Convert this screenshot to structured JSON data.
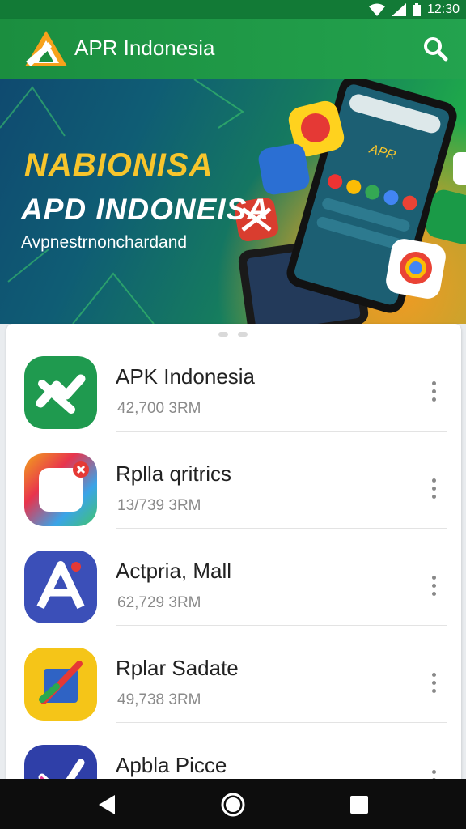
{
  "status_bar": {
    "time": "12:30",
    "icons": [
      "wifi-icon",
      "signal-icon",
      "battery-icon"
    ]
  },
  "app_bar": {
    "title": "APR Indonesia",
    "search_icon": "search-icon"
  },
  "banner": {
    "headline_1": "NABIONISA",
    "headline_2": "APD INDONEISA",
    "subtitle": "Avpnestrnonchardand",
    "phone_screen_label": "APR"
  },
  "apps": [
    {
      "name": "APK Indonesia",
      "meta": "42,700 3RM",
      "icon": "apk-indonesia-icon"
    },
    {
      "name": "Rplla qritrics",
      "meta": "13/739 3RM",
      "icon": "rplla-qritrics-icon"
    },
    {
      "name": "Actpria, Mall",
      "meta": "62,729 3RM",
      "icon": "actpria-mall-icon"
    },
    {
      "name": "Rplar Sadate",
      "meta": "49,738 3RM",
      "icon": "rplar-sadate-icon"
    },
    {
      "name": "Apbla Picce",
      "meta": "",
      "icon": "apbla-picce-icon"
    }
  ],
  "nav_bar": {
    "buttons": [
      "back-icon",
      "home-icon",
      "recents-icon"
    ]
  },
  "colors": {
    "primary": "#1b8e3f",
    "status_bar": "#127a36",
    "accent_yellow": "#f7c52c",
    "nav_bar": "#0d0d0d"
  }
}
